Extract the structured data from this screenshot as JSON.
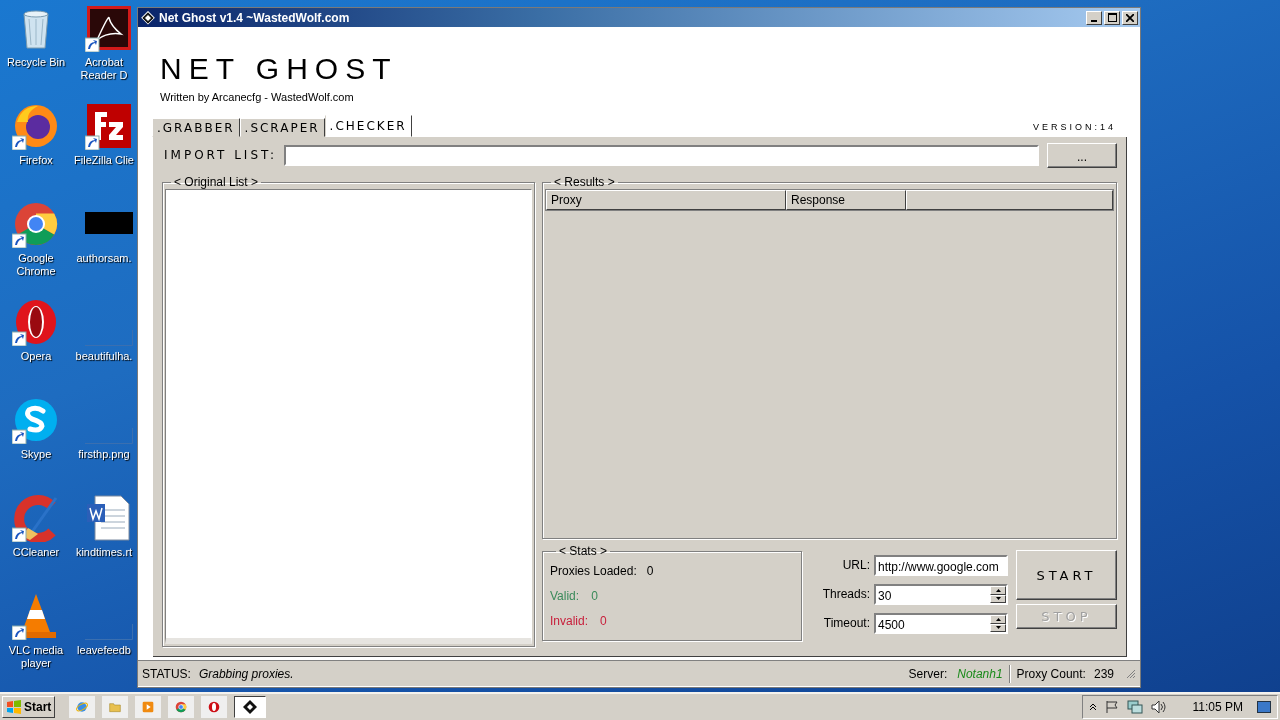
{
  "desktop_icons": [
    {
      "kind": "recycle",
      "label": "Recycle Bin"
    },
    {
      "kind": "acrobat",
      "label": "Acrobat Reader D"
    },
    {
      "kind": "firefox",
      "label": "Firefox"
    },
    {
      "kind": "filezilla",
      "label": "FileZilla Clie"
    },
    {
      "kind": "chrome",
      "label": "Google Chrome"
    },
    {
      "kind": "thumbnail",
      "label": "authorsam."
    },
    {
      "kind": "opera",
      "label": "Opera"
    },
    {
      "kind": "blank",
      "label": "beautifulha."
    },
    {
      "kind": "skype",
      "label": "Skype"
    },
    {
      "kind": "blank",
      "label": "firsthp.png"
    },
    {
      "kind": "ccleaner",
      "label": "CCleaner"
    },
    {
      "kind": "word",
      "label": "kindtimes.rt"
    },
    {
      "kind": "vlc",
      "label": "VLC media player"
    },
    {
      "kind": "blank",
      "label": "leavefeedb"
    }
  ],
  "window": {
    "title": "Net Ghost v1.4 ~WastedWolf.com",
    "logo": "NET GHOST",
    "credit": "Written by Arcanecfg - WastedWolf.com",
    "version": "VERSION:14"
  },
  "tabs": [
    {
      "label": ".GRABBER",
      "selected": false
    },
    {
      "label": ".SCRAPER",
      "selected": false
    },
    {
      "label": ".CHECKER",
      "selected": true
    }
  ],
  "import": {
    "label": "IMPORT LIST:",
    "browse_button": "..."
  },
  "original_list": {
    "title": "< Original List >"
  },
  "results": {
    "title": "< Results >",
    "columns": [
      "Proxy",
      "Response"
    ]
  },
  "stats": {
    "title": "< Stats >",
    "rows": [
      {
        "label": "Proxies Loaded:",
        "value": "0",
        "color": "#000000"
      },
      {
        "label": "Valid:",
        "value": "0",
        "color": "#3a8a5a"
      },
      {
        "label": "Invalid:",
        "value": "0",
        "color": "#c8203c"
      }
    ]
  },
  "settings": {
    "url_label": "URL:",
    "url": "http://www.google.com",
    "threads_label": "Threads:",
    "threads": "30",
    "timeout_label": "Timeout:",
    "timeout": "4500"
  },
  "buttons": [
    {
      "label": "START",
      "disabled": false
    },
    {
      "label": "STOP",
      "disabled": true
    }
  ],
  "status_bar": {
    "status_label": "STATUS:",
    "status": "Grabbing proxies.",
    "server_label": "Server:",
    "server": "Notanh1",
    "count_label": "Proxy Count:",
    "count": "239"
  },
  "taskbar": {
    "start": "Start",
    "apps": [
      {
        "kind": "ie",
        "active": false
      },
      {
        "kind": "folder",
        "active": false
      },
      {
        "kind": "media",
        "active": false
      },
      {
        "kind": "chrome",
        "active": false
      },
      {
        "kind": "opera",
        "active": false
      },
      {
        "kind": "netghost",
        "active": true
      }
    ],
    "clock": "11:05 PM"
  }
}
